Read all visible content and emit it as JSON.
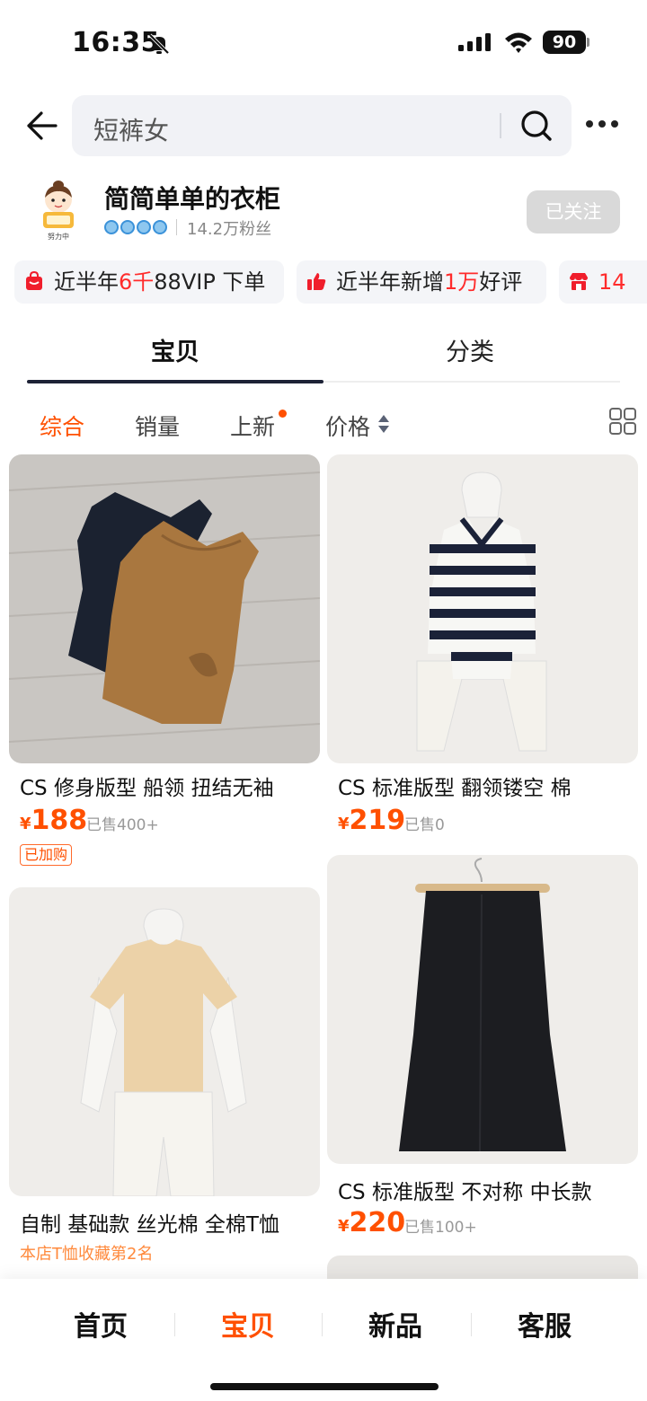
{
  "status_bar": {
    "time": "16:35",
    "battery": "90"
  },
  "search": {
    "query": "短裤女"
  },
  "shop": {
    "name": "简简单单的衣柜",
    "fans": "14.2万粉丝",
    "follow_label": "已关注",
    "avatar_caption": "努力中"
  },
  "highlights": [
    {
      "pre": "近半年",
      "hl": "6千",
      "post": "88VIP 下单"
    },
    {
      "pre": "近半年新增",
      "hl": "1万",
      "post": "好评"
    },
    {
      "pre": "",
      "hl": "14",
      "post": ""
    }
  ],
  "tabs": [
    {
      "label": "宝贝"
    },
    {
      "label": "分类"
    }
  ],
  "filters": [
    {
      "label": "综合"
    },
    {
      "label": "销量"
    },
    {
      "label": "上新"
    },
    {
      "label": "价格"
    }
  ],
  "products": [
    {
      "title": "CS 修身版型 船领 扭结无袖",
      "currency": "¥",
      "price": "188",
      "sold": "已售400+",
      "tag": "已加购"
    },
    {
      "title": "CS  标准版型 翻领镂空   棉",
      "currency": "¥",
      "price": "219",
      "sold": "已售0"
    },
    {
      "title": "自制 基础款 丝光棉 全棉T恤",
      "rank": "本店T恤收藏第2名"
    },
    {
      "title": "CS 标准版型 不对称 中长款",
      "currency": "¥",
      "price": "220",
      "sold": "已售100+"
    }
  ],
  "bottom_nav": [
    {
      "label": "首页"
    },
    {
      "label": "宝贝"
    },
    {
      "label": "新品"
    },
    {
      "label": "客服"
    }
  ]
}
